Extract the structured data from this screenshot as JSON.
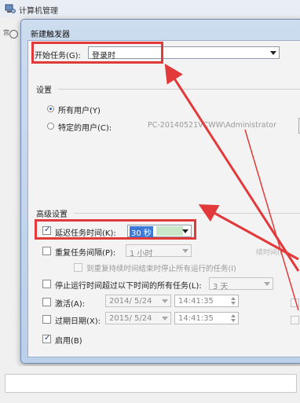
{
  "outer": {
    "title": "计算机管理",
    "frag": "宫"
  },
  "dialog": {
    "title": "新建触发器",
    "start_task": {
      "label": "开始任务(G):",
      "value": "登录时"
    },
    "settings": {
      "title": "设置",
      "all_users": "所有用户(Y)",
      "specific_user": "特定的用户(C):",
      "user_value": "PC-20140521VCWW\\Administrator"
    },
    "advanced": {
      "title": "高级设置",
      "delay": {
        "label": "延迟任务时间(K):",
        "value": "30 秒",
        "checked": true
      },
      "repeat": {
        "label": "重复任务间隔(P):",
        "value": "1 小时",
        "checked": false,
        "right_faint": "续时间(F):"
      },
      "stop_running": "到重复持续时间结束时停止所有运行的任务(I)",
      "stop_longer": {
        "label": "停止运行时间超过以下时间的所有任务(L):",
        "value": "3 天",
        "checked": false
      },
      "activate": {
        "label": "激活(A):",
        "date": "2014/  5/24",
        "time": "14:41:35",
        "checked": false
      },
      "expire": {
        "label": "过期日期(X):",
        "date": "2015/  5/24",
        "time": "14:41:35",
        "checked": false
      },
      "enabled": {
        "label": "启用(B)",
        "checked": true
      }
    }
  },
  "colors": {
    "highlight": "#e23a3a",
    "arrow": "#e23a3a",
    "selection": "#3b78d8"
  }
}
